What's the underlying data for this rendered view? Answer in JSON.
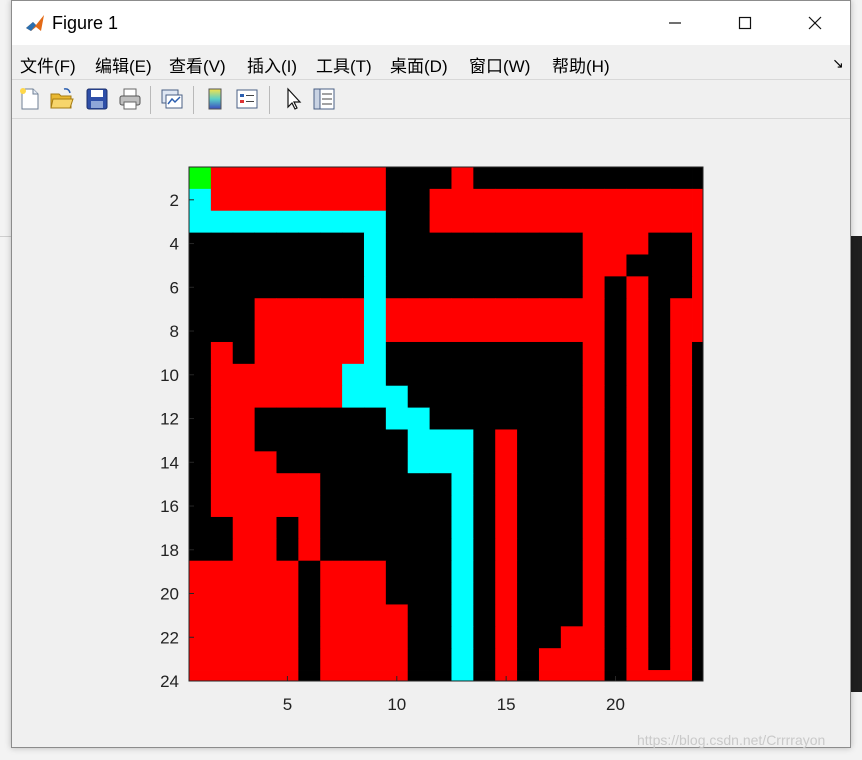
{
  "window": {
    "title": "Figure 1",
    "controls": {
      "minimize": "—",
      "maximize": "☐",
      "close": "✕"
    }
  },
  "menu": {
    "items": [
      "文件(F)",
      "编辑(E)",
      "查看(V)",
      "插入(I)",
      "工具(T)",
      "桌面(D)",
      "窗口(W)",
      "帮助(H)"
    ],
    "dock_arrow": "↘"
  },
  "toolbar": {
    "buttons": [
      "new-figure-icon",
      "open-file-icon",
      "save-icon",
      "print-icon",
      "link-plot-icon",
      "colorbar-icon",
      "legend-icon",
      "pointer-icon",
      "property-inspector-icon"
    ]
  },
  "colors": {
    "wall": "#000000",
    "explored": "#ff0000",
    "path": "#00ffff",
    "start": "#00ff00",
    "goal": "#ffff00"
  },
  "axes": {
    "x_ticks": [
      "5",
      "10",
      "15",
      "20"
    ],
    "y_ticks": [
      "2",
      "4",
      "6",
      "8",
      "10",
      "12",
      "14",
      "16",
      "18",
      "20",
      "22",
      "24"
    ]
  },
  "chart_data": {
    "type": "heatmap",
    "title": "",
    "xlabel": "",
    "ylabel": "",
    "xlim": [
      0.5,
      24
    ],
    "ylim": [
      0.5,
      24
    ],
    "legend_codes": {
      "0": "black",
      "1": "red",
      "2": "cyan",
      "3": "green",
      "4": "yellow"
    },
    "grid": [
      "311111111000100000000000",
      "211111111001111111111111",
      "222222222001111111111111",
      "000000002000000000111001",
      "000000002000000000110001",
      "000000002000000000101001",
      "000111112111111111101011",
      "000111112111111111101011",
      "010111112000000000101010",
      "011111122000000000101010",
      "011111122200000000101010",
      "011000000220000000101010",
      "011000000022201000101010",
      "011100000022201000101010",
      "011111000000201000101010",
      "011111000000201000101010",
      "001101000000201000101010",
      "001101000000201000101010",
      "111110111000201000101010",
      "111110111000201000101010",
      "111110111100201000101010",
      "111110111100201001101010",
      "111110111100201011101010",
      "111110111100201011101110"
    ]
  },
  "watermark": "https://blog.csdn.net/Crrrrayon"
}
